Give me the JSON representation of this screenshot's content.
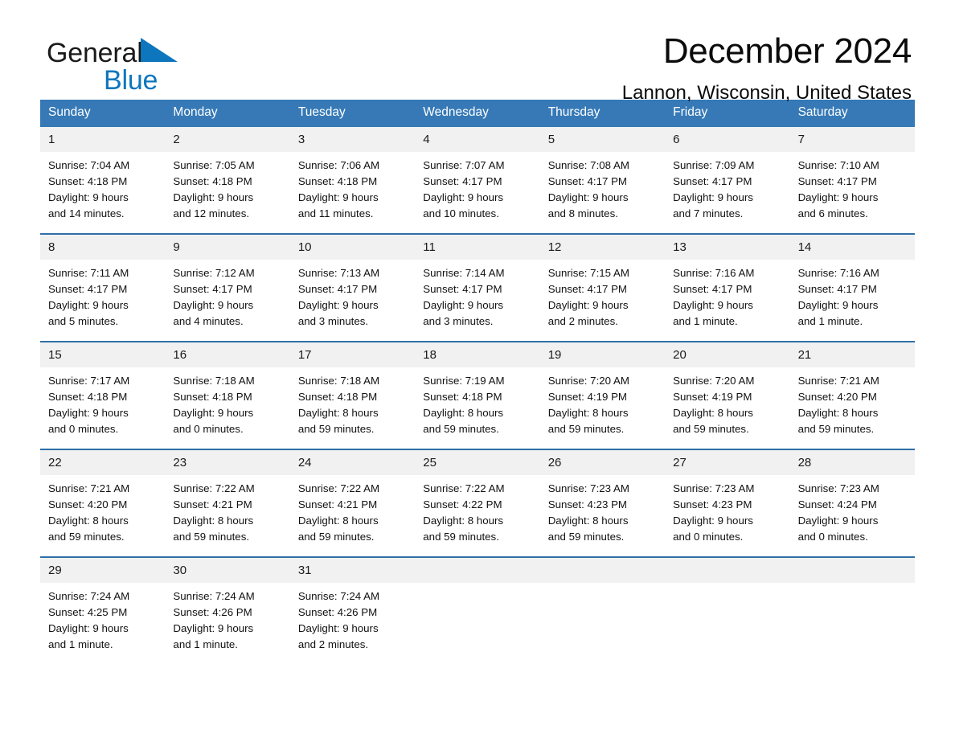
{
  "brand": {
    "name_part1": "General",
    "name_part2": "Blue",
    "triangle_color": "#0d76bd"
  },
  "header": {
    "month_title": "December 2024",
    "location": "Lannon, Wisconsin, United States"
  },
  "calendar": {
    "header_color": "#3679b6",
    "weekdays": [
      "Sunday",
      "Monday",
      "Tuesday",
      "Wednesday",
      "Thursday",
      "Friday",
      "Saturday"
    ],
    "weeks": [
      [
        {
          "day": "1",
          "sunrise": "Sunrise: 7:04 AM",
          "sunset": "Sunset: 4:18 PM",
          "daylight_line1": "Daylight: 9 hours",
          "daylight_line2": "and 14 minutes."
        },
        {
          "day": "2",
          "sunrise": "Sunrise: 7:05 AM",
          "sunset": "Sunset: 4:18 PM",
          "daylight_line1": "Daylight: 9 hours",
          "daylight_line2": "and 12 minutes."
        },
        {
          "day": "3",
          "sunrise": "Sunrise: 7:06 AM",
          "sunset": "Sunset: 4:18 PM",
          "daylight_line1": "Daylight: 9 hours",
          "daylight_line2": "and 11 minutes."
        },
        {
          "day": "4",
          "sunrise": "Sunrise: 7:07 AM",
          "sunset": "Sunset: 4:17 PM",
          "daylight_line1": "Daylight: 9 hours",
          "daylight_line2": "and 10 minutes."
        },
        {
          "day": "5",
          "sunrise": "Sunrise: 7:08 AM",
          "sunset": "Sunset: 4:17 PM",
          "daylight_line1": "Daylight: 9 hours",
          "daylight_line2": "and 8 minutes."
        },
        {
          "day": "6",
          "sunrise": "Sunrise: 7:09 AM",
          "sunset": "Sunset: 4:17 PM",
          "daylight_line1": "Daylight: 9 hours",
          "daylight_line2": "and 7 minutes."
        },
        {
          "day": "7",
          "sunrise": "Sunrise: 7:10 AM",
          "sunset": "Sunset: 4:17 PM",
          "daylight_line1": "Daylight: 9 hours",
          "daylight_line2": "and 6 minutes."
        }
      ],
      [
        {
          "day": "8",
          "sunrise": "Sunrise: 7:11 AM",
          "sunset": "Sunset: 4:17 PM",
          "daylight_line1": "Daylight: 9 hours",
          "daylight_line2": "and 5 minutes."
        },
        {
          "day": "9",
          "sunrise": "Sunrise: 7:12 AM",
          "sunset": "Sunset: 4:17 PM",
          "daylight_line1": "Daylight: 9 hours",
          "daylight_line2": "and 4 minutes."
        },
        {
          "day": "10",
          "sunrise": "Sunrise: 7:13 AM",
          "sunset": "Sunset: 4:17 PM",
          "daylight_line1": "Daylight: 9 hours",
          "daylight_line2": "and 3 minutes."
        },
        {
          "day": "11",
          "sunrise": "Sunrise: 7:14 AM",
          "sunset": "Sunset: 4:17 PM",
          "daylight_line1": "Daylight: 9 hours",
          "daylight_line2": "and 3 minutes."
        },
        {
          "day": "12",
          "sunrise": "Sunrise: 7:15 AM",
          "sunset": "Sunset: 4:17 PM",
          "daylight_line1": "Daylight: 9 hours",
          "daylight_line2": "and 2 minutes."
        },
        {
          "day": "13",
          "sunrise": "Sunrise: 7:16 AM",
          "sunset": "Sunset: 4:17 PM",
          "daylight_line1": "Daylight: 9 hours",
          "daylight_line2": "and 1 minute."
        },
        {
          "day": "14",
          "sunrise": "Sunrise: 7:16 AM",
          "sunset": "Sunset: 4:17 PM",
          "daylight_line1": "Daylight: 9 hours",
          "daylight_line2": "and 1 minute."
        }
      ],
      [
        {
          "day": "15",
          "sunrise": "Sunrise: 7:17 AM",
          "sunset": "Sunset: 4:18 PM",
          "daylight_line1": "Daylight: 9 hours",
          "daylight_line2": "and 0 minutes."
        },
        {
          "day": "16",
          "sunrise": "Sunrise: 7:18 AM",
          "sunset": "Sunset: 4:18 PM",
          "daylight_line1": "Daylight: 9 hours",
          "daylight_line2": "and 0 minutes."
        },
        {
          "day": "17",
          "sunrise": "Sunrise: 7:18 AM",
          "sunset": "Sunset: 4:18 PM",
          "daylight_line1": "Daylight: 8 hours",
          "daylight_line2": "and 59 minutes."
        },
        {
          "day": "18",
          "sunrise": "Sunrise: 7:19 AM",
          "sunset": "Sunset: 4:18 PM",
          "daylight_line1": "Daylight: 8 hours",
          "daylight_line2": "and 59 minutes."
        },
        {
          "day": "19",
          "sunrise": "Sunrise: 7:20 AM",
          "sunset": "Sunset: 4:19 PM",
          "daylight_line1": "Daylight: 8 hours",
          "daylight_line2": "and 59 minutes."
        },
        {
          "day": "20",
          "sunrise": "Sunrise: 7:20 AM",
          "sunset": "Sunset: 4:19 PM",
          "daylight_line1": "Daylight: 8 hours",
          "daylight_line2": "and 59 minutes."
        },
        {
          "day": "21",
          "sunrise": "Sunrise: 7:21 AM",
          "sunset": "Sunset: 4:20 PM",
          "daylight_line1": "Daylight: 8 hours",
          "daylight_line2": "and 59 minutes."
        }
      ],
      [
        {
          "day": "22",
          "sunrise": "Sunrise: 7:21 AM",
          "sunset": "Sunset: 4:20 PM",
          "daylight_line1": "Daylight: 8 hours",
          "daylight_line2": "and 59 minutes."
        },
        {
          "day": "23",
          "sunrise": "Sunrise: 7:22 AM",
          "sunset": "Sunset: 4:21 PM",
          "daylight_line1": "Daylight: 8 hours",
          "daylight_line2": "and 59 minutes."
        },
        {
          "day": "24",
          "sunrise": "Sunrise: 7:22 AM",
          "sunset": "Sunset: 4:21 PM",
          "daylight_line1": "Daylight: 8 hours",
          "daylight_line2": "and 59 minutes."
        },
        {
          "day": "25",
          "sunrise": "Sunrise: 7:22 AM",
          "sunset": "Sunset: 4:22 PM",
          "daylight_line1": "Daylight: 8 hours",
          "daylight_line2": "and 59 minutes."
        },
        {
          "day": "26",
          "sunrise": "Sunrise: 7:23 AM",
          "sunset": "Sunset: 4:23 PM",
          "daylight_line1": "Daylight: 8 hours",
          "daylight_line2": "and 59 minutes."
        },
        {
          "day": "27",
          "sunrise": "Sunrise: 7:23 AM",
          "sunset": "Sunset: 4:23 PM",
          "daylight_line1": "Daylight: 9 hours",
          "daylight_line2": "and 0 minutes."
        },
        {
          "day": "28",
          "sunrise": "Sunrise: 7:23 AM",
          "sunset": "Sunset: 4:24 PM",
          "daylight_line1": "Daylight: 9 hours",
          "daylight_line2": "and 0 minutes."
        }
      ],
      [
        {
          "day": "29",
          "sunrise": "Sunrise: 7:24 AM",
          "sunset": "Sunset: 4:25 PM",
          "daylight_line1": "Daylight: 9 hours",
          "daylight_line2": "and 1 minute."
        },
        {
          "day": "30",
          "sunrise": "Sunrise: 7:24 AM",
          "sunset": "Sunset: 4:26 PM",
          "daylight_line1": "Daylight: 9 hours",
          "daylight_line2": "and 1 minute."
        },
        {
          "day": "31",
          "sunrise": "Sunrise: 7:24 AM",
          "sunset": "Sunset: 4:26 PM",
          "daylight_line1": "Daylight: 9 hours",
          "daylight_line2": "and 2 minutes."
        },
        {
          "day": "",
          "sunrise": "",
          "sunset": "",
          "daylight_line1": "",
          "daylight_line2": ""
        },
        {
          "day": "",
          "sunrise": "",
          "sunset": "",
          "daylight_line1": "",
          "daylight_line2": ""
        },
        {
          "day": "",
          "sunrise": "",
          "sunset": "",
          "daylight_line1": "",
          "daylight_line2": ""
        },
        {
          "day": "",
          "sunrise": "",
          "sunset": "",
          "daylight_line1": "",
          "daylight_line2": ""
        }
      ]
    ]
  }
}
